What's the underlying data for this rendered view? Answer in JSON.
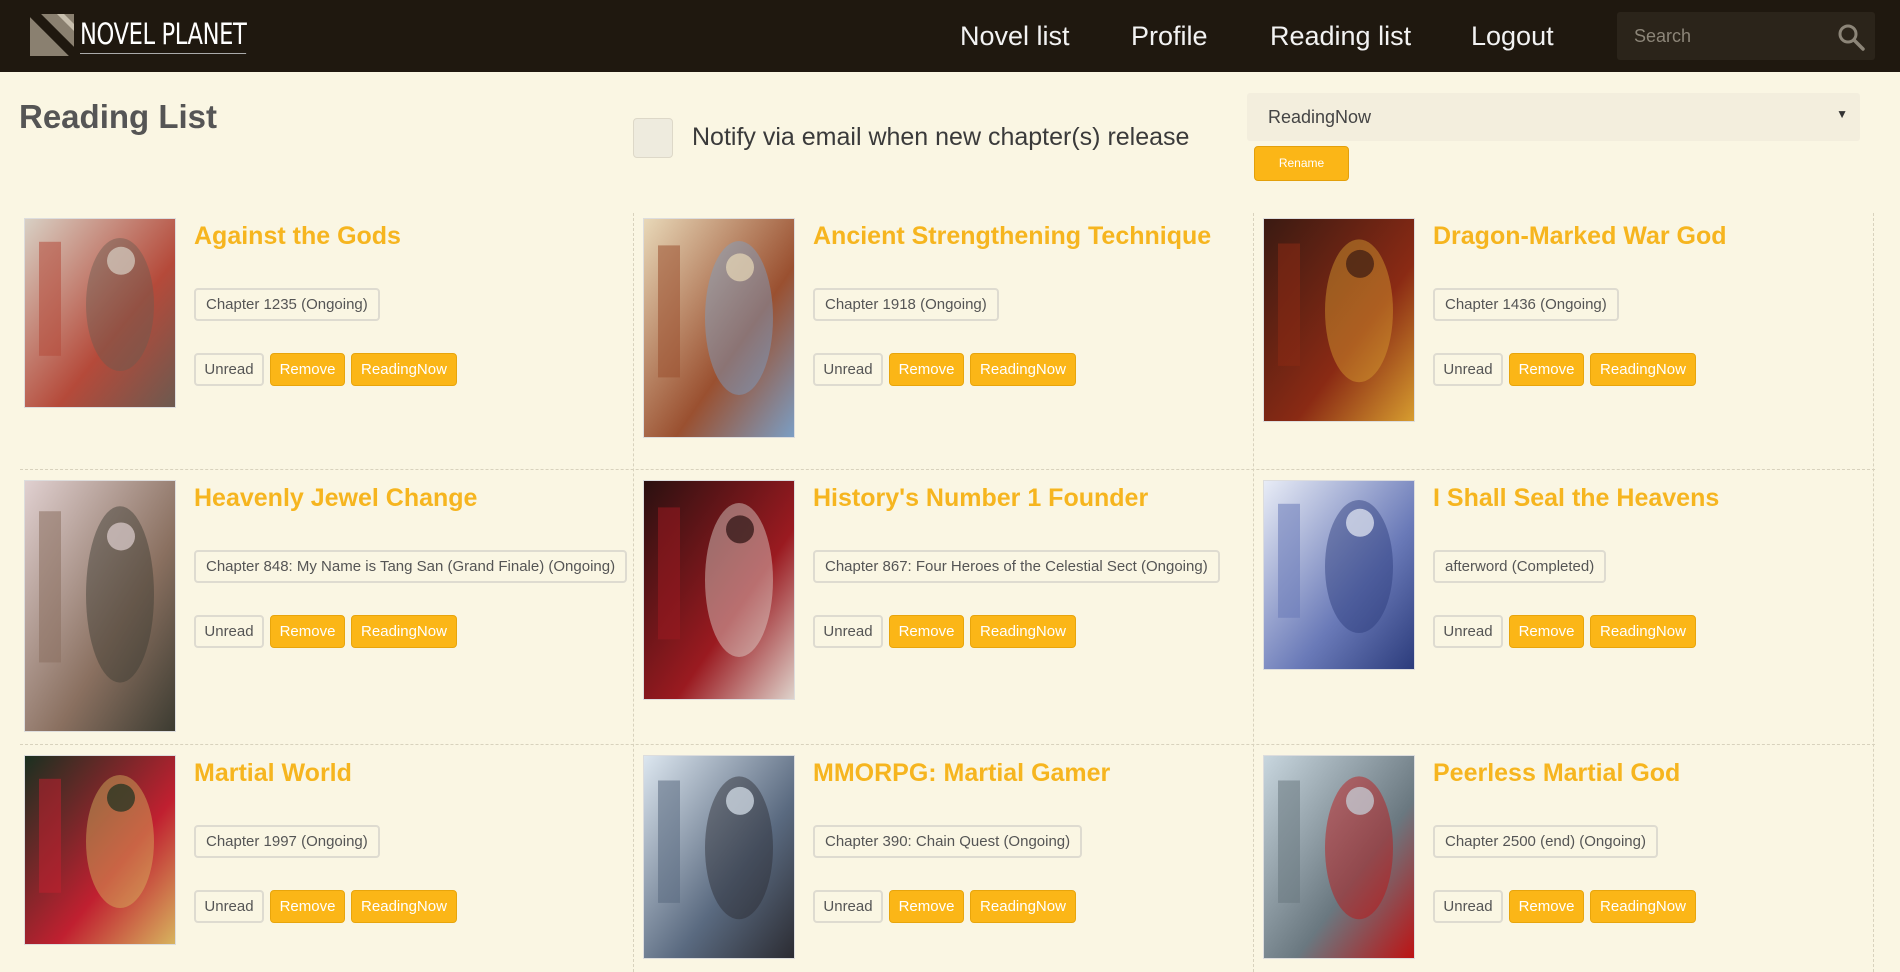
{
  "header": {
    "logo_text": "NOVEL PLANET",
    "nav": {
      "novel_list": "Novel list",
      "profile": "Profile",
      "reading_list": "Reading list",
      "logout": "Logout"
    },
    "search_placeholder": "Search",
    "search_icon": "search-icon"
  },
  "page": {
    "title": "Reading List",
    "notify_label": "Notify via email when new chapter(s) release",
    "notify_checked": false,
    "list_select_value": "ReadingNow",
    "rename_label": "Rename"
  },
  "buttons": {
    "unread": "Unread",
    "remove": "Remove",
    "reading": "ReadingNow"
  },
  "novels": [
    {
      "title": "Against the Gods",
      "chapter": "Chapter 1235 (Ongoing)",
      "cover_colors": [
        "#d8d0c4",
        "#b54a3a",
        "#6a5a50"
      ]
    },
    {
      "title": "Ancient Strengthening Technique",
      "chapter": "Chapter 1918 (Ongoing)",
      "cover_colors": [
        "#e8d8b8",
        "#9a5030",
        "#7aa0c8"
      ]
    },
    {
      "title": "Dragon-Marked War God",
      "chapter": "Chapter 1436 (Ongoing)",
      "cover_colors": [
        "#3a1a12",
        "#8a2a14",
        "#d9a030"
      ]
    },
    {
      "title": "Heavenly Jewel Change",
      "chapter": "Chapter 848: My Name is Tang San (Grand Finale) (Ongoing)",
      "cover_colors": [
        "#e0d0d0",
        "#8a7060",
        "#3a3a30"
      ]
    },
    {
      "title": "History's Number 1 Founder",
      "chapter": "Chapter 867: Four Heroes of the Celestial Sect (Ongoing)",
      "cover_colors": [
        "#2a1010",
        "#9a1a20",
        "#e0d8d0"
      ]
    },
    {
      "title": "I Shall Seal the Heavens",
      "chapter": "afterword (Completed)",
      "cover_colors": [
        "#e8ecf6",
        "#6a7ab8",
        "#2a3a7a"
      ]
    },
    {
      "title": "Martial World",
      "chapter": "Chapter 1997 (Ongoing)",
      "cover_colors": [
        "#1a3020",
        "#c02030",
        "#d8b860"
      ]
    },
    {
      "title": "MMORPG: Martial Gamer",
      "chapter": "Chapter 390: Chain Quest (Ongoing)",
      "cover_colors": [
        "#dce6ef",
        "#5a6a80",
        "#2a2a30"
      ]
    },
    {
      "title": "Peerless Martial God",
      "chapter": "Chapter 2500 (end) (Ongoing)",
      "cover_colors": [
        "#c8d6de",
        "#6a7880",
        "#c01010"
      ]
    }
  ]
}
